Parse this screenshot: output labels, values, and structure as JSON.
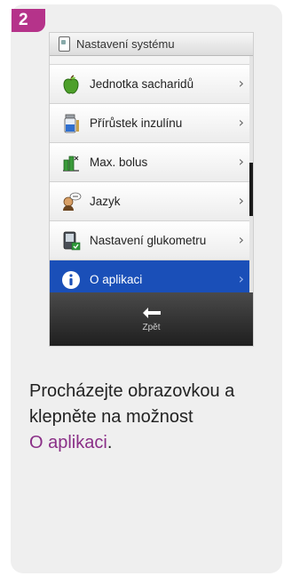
{
  "step_number": "2",
  "screen": {
    "title": "Nastavení systému",
    "menu_items": [
      {
        "label": "Jednotka sacharidů",
        "icon": "apple-icon"
      },
      {
        "label": "Přírůstek inzulínu",
        "icon": "vial-icon"
      },
      {
        "label": "Max. bolus",
        "icon": "max-bolus-icon"
      },
      {
        "label": "Jazyk",
        "icon": "language-person-icon"
      },
      {
        "label": "Nastavení glukometru",
        "icon": "meter-settings-icon"
      },
      {
        "label": "O aplikaci",
        "icon": "info-icon",
        "selected": true
      }
    ],
    "back_label": "Zpět"
  },
  "instruction": {
    "line1": "Procházejte obrazovkou a",
    "line2": "klepněte na možnost",
    "link_text": "O aplikaci",
    "suffix": "."
  },
  "colors": {
    "accent_badge": "#b5338a",
    "selected_row": "#1a4fb8",
    "link": "#8a2f87"
  }
}
